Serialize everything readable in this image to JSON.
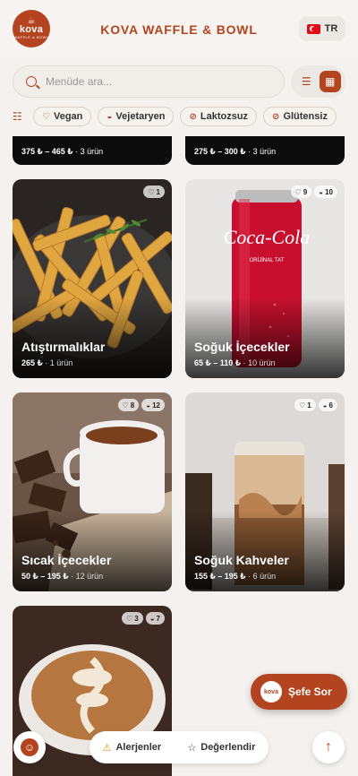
{
  "header": {
    "logo_text": "kova",
    "logo_sub": "WAFFLE & BOWL",
    "title": "KOVA WAFFLE & BOWL",
    "lang": "TR"
  },
  "search": {
    "placeholder": "Menüde ara..."
  },
  "filters": [
    {
      "label": "Vegan",
      "icon": "vegan-icon"
    },
    {
      "label": "Vejetaryen",
      "icon": "vegetarian-icon"
    },
    {
      "label": "Laktozsuz",
      "icon": "lactose-free-icon"
    },
    {
      "label": "Glütensiz",
      "icon": "gluten-free-icon"
    }
  ],
  "top_cards": [
    {
      "price": "375 ₺ – 465 ₺",
      "count": "· 3 ürün"
    },
    {
      "price": "275 ₺ – 300 ₺",
      "count": "· 3 ürün"
    }
  ],
  "categories": [
    {
      "name": "Atıştırmalıklar",
      "price": "265 ₺",
      "count": "· 1 ürün",
      "badges": [
        {
          "icon": "vegan-icon",
          "n": "1"
        }
      ],
      "bg": "fries"
    },
    {
      "name": "Soğuk İçecekler",
      "price": "65 ₺ – 110 ₺",
      "count": "· 10 ürün",
      "badges": [
        {
          "icon": "vegan-icon",
          "n": "9"
        },
        {
          "icon": "vegetarian-icon",
          "n": "10"
        }
      ],
      "bg": "cola"
    },
    {
      "name": "Sıcak İçecekler",
      "price": "50 ₺ – 195 ₺",
      "count": "· 12 ürün",
      "badges": [
        {
          "icon": "vegan-icon",
          "n": "8"
        },
        {
          "icon": "vegetarian-icon",
          "n": "12"
        }
      ],
      "bg": "chocolate"
    },
    {
      "name": "Soğuk Kahveler",
      "price": "155 ₺ – 195 ₺",
      "count": "· 6 ürün",
      "badges": [
        {
          "icon": "vegan-icon",
          "n": "1"
        },
        {
          "icon": "vegetarian-icon",
          "n": "6"
        }
      ],
      "bg": "iced"
    },
    {
      "name": "",
      "price": "",
      "count": "",
      "badges": [
        {
          "icon": "vegan-icon",
          "n": "3"
        },
        {
          "icon": "vegetarian-icon",
          "n": "7"
        }
      ],
      "bg": "latte"
    }
  ],
  "chef": {
    "label": "Şefe Sor",
    "logo": "kova"
  },
  "bottom": {
    "allergens": "Alerjenler",
    "review": "Değerlendir"
  },
  "colors": {
    "accent": "#b4441f"
  }
}
